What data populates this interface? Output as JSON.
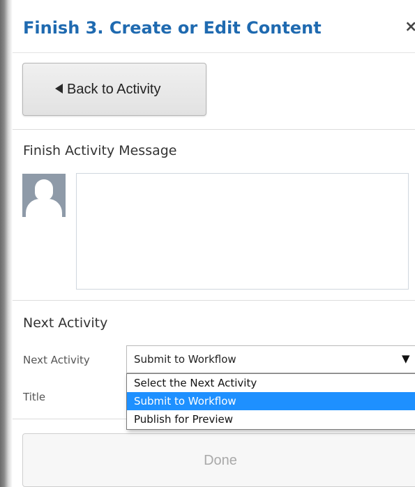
{
  "panel": {
    "title": "Finish 3. Create or Edit Content",
    "close_symbol": "×"
  },
  "back_button": {
    "label": "Back to Activity"
  },
  "message_section": {
    "title": "Finish Activity Message",
    "avatar_icon": "user-silhouette-icon",
    "message_value": ""
  },
  "next_activity_section": {
    "title": "Next Activity",
    "next_activity_label": "Next Activity",
    "title_label": "Title",
    "select": {
      "selected_value": "Submit to Workflow",
      "arrow_symbol": "▼",
      "options": [
        "Select the Next Activity",
        "Submit to Workflow",
        "Publish for Preview"
      ],
      "highlighted_index": 1
    }
  },
  "done_button": {
    "label": "Done"
  },
  "colors": {
    "title": "#1f6ab0",
    "highlight": "#1e90ff",
    "avatar_bg": "#8e9aa8"
  }
}
